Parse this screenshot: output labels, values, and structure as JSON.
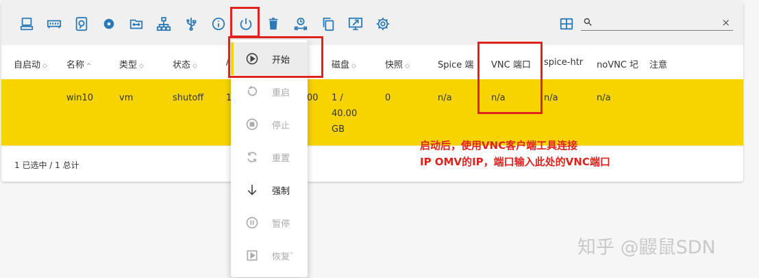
{
  "search": {
    "placeholder": "",
    "clear": "×"
  },
  "toolbar_icons": [
    "computer-icon",
    "memory-icon",
    "disk-icon",
    "disc-icon",
    "folder-icon",
    "network-icon",
    "usb-icon",
    "info-icon",
    "power-icon",
    "trash-icon",
    "migrate-icon",
    "copy-icon",
    "remote-display-icon",
    "settings-icon"
  ],
  "table": {
    "headers": [
      {
        "label": "自启动",
        "sort": "◇"
      },
      {
        "label": "名称",
        "sort": "^"
      },
      {
        "label": "类型",
        "sort": "◇"
      },
      {
        "label": "状态",
        "sort": "◇"
      },
      {
        "label": "/"
      },
      {
        "label": "磁盘",
        "sort": "◇"
      },
      {
        "label": "快照",
        "sort": "◇"
      },
      {
        "label": "Spice 端"
      },
      {
        "label": "VNC 端口"
      },
      {
        "label": "spice-htr"
      },
      {
        "label": "noVNC 圮"
      },
      {
        "label": "注意"
      }
    ],
    "row": {
      "autostart": "",
      "name": "win10",
      "type": "vm",
      "state": "shutoff",
      "col5_left": "1",
      "col5_right": "00",
      "disk": [
        "1 /",
        "40.00",
        "GB"
      ],
      "snapshots": "0",
      "spice_port": "n/a",
      "vnc_port": "n/a",
      "spice_html": "n/a",
      "novnc": "n/a"
    },
    "footer": "1 已选中 / 1 总计"
  },
  "menu": {
    "items": [
      {
        "label": "开始",
        "icon": "play-circle-icon",
        "enabled": true,
        "highlighted": true
      },
      {
        "label": "重启",
        "icon": "restart-icon",
        "enabled": false
      },
      {
        "label": "停止",
        "icon": "stop-circle-icon",
        "enabled": false
      },
      {
        "label": "重置",
        "icon": "reset-icon",
        "enabled": false
      },
      {
        "label": "强制",
        "icon": "arrow-down-icon",
        "enabled": true
      },
      {
        "label": "暂停",
        "icon": "pause-circle-icon",
        "enabled": false
      },
      {
        "label": "恢复`",
        "icon": "resume-icon",
        "enabled": false
      }
    ]
  },
  "annotation": {
    "line1": "启动后，使用VNC客户端工具连接",
    "line2": "IP OMV的IP，端口输入此处的VNC端口",
    "color": "#e0221c"
  },
  "watermark": "知乎 @鼹鼠SDN",
  "colors": {
    "accent": "#2a7ab8",
    "selected_row": "#f7d300",
    "highlight": "#e0221c"
  }
}
